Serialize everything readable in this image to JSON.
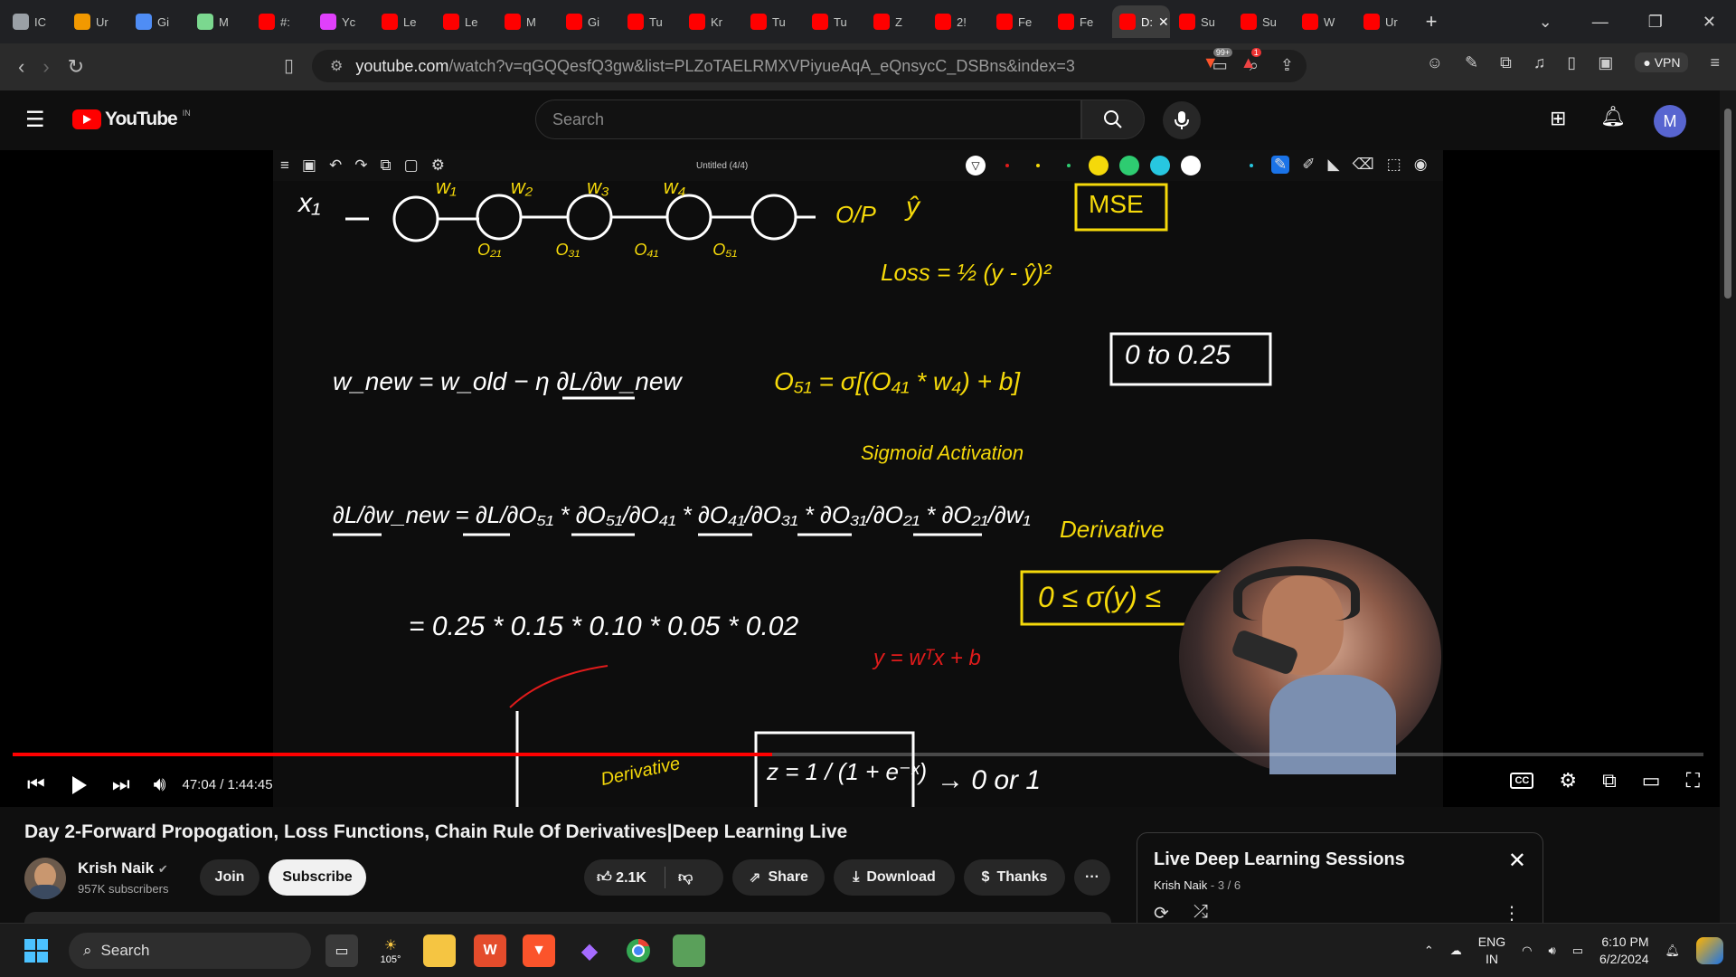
{
  "browser": {
    "tabs": [
      {
        "label": "IC",
        "color": "#9aa0a6"
      },
      {
        "label": "Ur",
        "color": "#f29900"
      },
      {
        "label": "Gi",
        "color": "#4f8df5"
      },
      {
        "label": "M",
        "color": "#7bd88f"
      },
      {
        "label": "#:",
        "color": "#ff0000"
      },
      {
        "label": "Yc",
        "color": "#e040fb"
      },
      {
        "label": "Le",
        "color": "#ff0000"
      },
      {
        "label": "Le",
        "color": "#ff0000"
      },
      {
        "label": "M",
        "color": "#ff0000"
      },
      {
        "label": "Gi",
        "color": "#ff0000"
      },
      {
        "label": "Tu",
        "color": "#ff0000"
      },
      {
        "label": "Kr",
        "color": "#ff0000"
      },
      {
        "label": "Tu",
        "color": "#ff0000"
      },
      {
        "label": "Tu",
        "color": "#ff0000"
      },
      {
        "label": "Z",
        "color": "#ff0000"
      },
      {
        "label": "2!",
        "color": "#ff0000"
      },
      {
        "label": "Fe",
        "color": "#ff0000"
      },
      {
        "label": "Fe",
        "color": "#ff0000"
      },
      {
        "label": "D:",
        "color": "#ff0000",
        "active": true
      },
      {
        "label": "Su",
        "color": "#ff0000"
      },
      {
        "label": "Su",
        "color": "#ff0000"
      },
      {
        "label": "W",
        "color": "#ff0000"
      },
      {
        "label": "Ur",
        "color": "#ff0000"
      }
    ],
    "new_tab": "+",
    "url_host": "youtube.com",
    "url_rest": "/watch?v=qGQQesfQ3gw&list=PLZoTAELRMXVPiyueAqA_eQnsycC_DSBns&index=3",
    "brave_badge": "99+",
    "alert_badge": "1",
    "vpn_label": "VPN"
  },
  "youtube": {
    "logo_text": "YouTube",
    "region": "IN",
    "search_placeholder": "Search",
    "avatar_letter": "M",
    "accent": "#ff0000"
  },
  "player": {
    "whiteboard_title": "Untitled (4/4)",
    "palette": [
      "#f5d90a",
      "#2ecc71",
      "#27c7e0",
      "#ffffff"
    ],
    "time": "47:04 / 1:44:45",
    "progress": 0.449,
    "board": {
      "inputs": "x₁",
      "weights": [
        "w₁",
        "w₂",
        "w₃",
        "w₄"
      ],
      "outputs": [
        "O₂₁",
        "O₃₁",
        "O₄₁",
        "O₅₁"
      ],
      "op": "O/P",
      "yhat": "ŷ",
      "mse": "MSE",
      "loss": "Loss = ½ (y - ŷ)²",
      "range": "0 to 0.25",
      "o51": "O₅₁ = σ[(O₄₁ * w₄) + b]",
      "sigmoid": "Sigmoid Activation",
      "wnew": "w_new = w_old − η ∂L/∂w_new",
      "chain": "∂L/∂w_new = ∂L/∂O₅₁ * ∂O₅₁/∂O₄₁ * ∂O₄₁/∂O₃₁ * ∂O₃₁/∂O₂₁ * ∂O₂₁/∂w₁",
      "numbers": "= 0.25 * 0.15 * 0.10 * 0.05 * 0.02",
      "linear": "y = wᵀx + b",
      "derivative_label": "Derivative",
      "sigma_range": "0 ≤ σ(y) ≤",
      "z_eq": "z = 1 / (1 + e⁻ˣ)",
      "to01": "→ 0 or 1",
      "derivative_small": "Derivative"
    }
  },
  "video": {
    "title": "Day 2-Forward Propogation, Loss Functions, Chain Rule Of Derivatives|Deep Learning Live",
    "channel": "Krish Naik",
    "subscribers": "957K subscribers",
    "join": "Join",
    "subscribe": "Subscribe",
    "likes": "2.1K",
    "share": "Share",
    "download": "Download",
    "thanks": "Thanks",
    "more": "···"
  },
  "playlist": {
    "title": "Live Deep Learning Sessions",
    "meta_channel": "Krish Naik",
    "meta_pos": "3 / 6"
  },
  "taskbar": {
    "search": "Search",
    "weather": "105°",
    "lang1": "ENG",
    "lang2": "IN",
    "time": "6:10 PM",
    "date": "6/2/2024"
  }
}
